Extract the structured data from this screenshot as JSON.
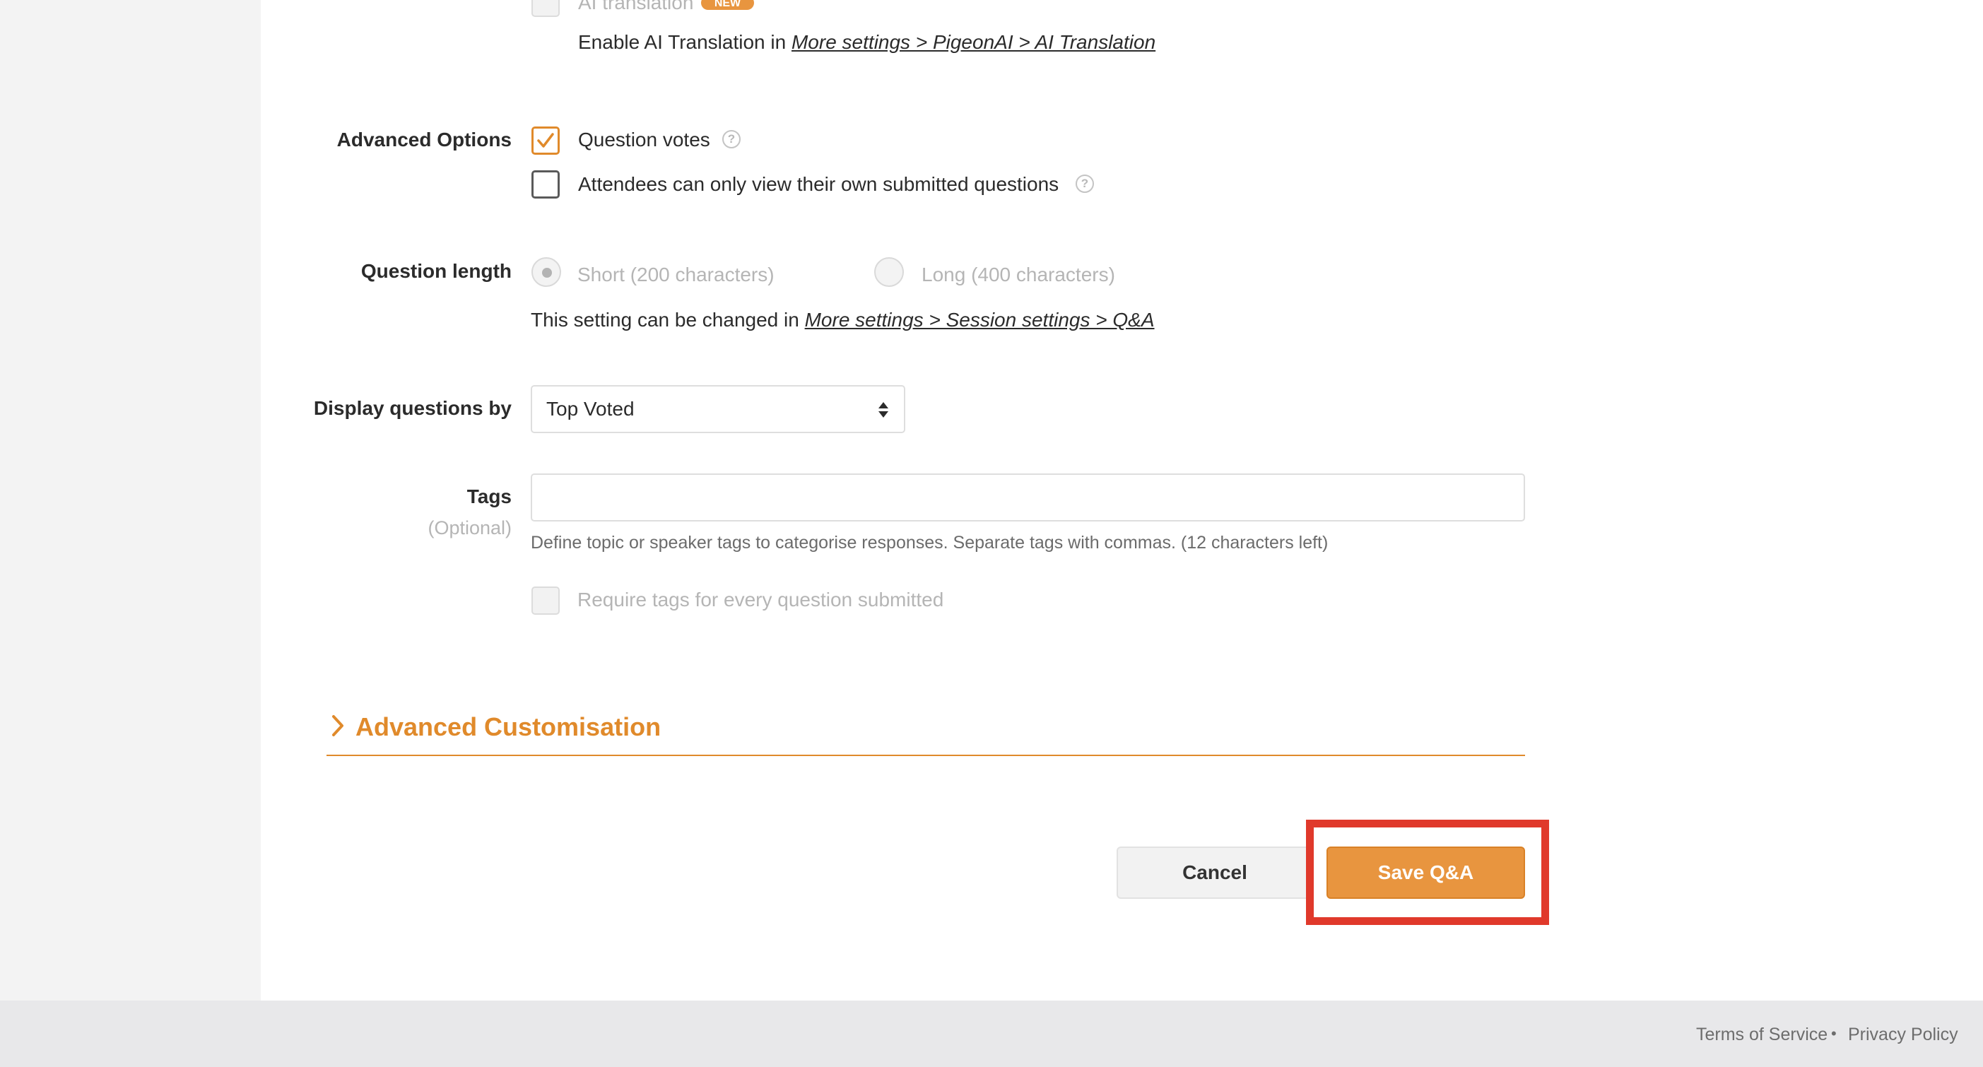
{
  "ai_translation": {
    "label": "AI translation",
    "badge": "NEW",
    "hint_prefix": "Enable AI Translation in",
    "hint_link": "More settings > PigeonAI > AI Translation"
  },
  "advanced_options": {
    "label": "Advanced Options",
    "question_votes": {
      "label": "Question votes",
      "checked": true
    },
    "own_questions_only": {
      "label": "Attendees can only view their own submitted questions",
      "checked": false
    }
  },
  "question_length": {
    "label": "Question length",
    "options": [
      "Short (200 characters)",
      "Long (400 characters)"
    ],
    "selected": "Short (200 characters)",
    "hint_prefix": "This setting can be changed in",
    "hint_link": "More settings > Session settings > Q&A"
  },
  "display_questions": {
    "label": "Display questions by",
    "value": "Top Voted"
  },
  "tags": {
    "label": "Tags",
    "optional": "(Optional)",
    "value": "",
    "help": "Define topic or speaker tags to categorise responses. Separate tags with commas. (12 characters left)",
    "require_label": "Require tags for every question submitted"
  },
  "advanced_customisation": {
    "label": "Advanced Customisation"
  },
  "actions": {
    "cancel": "Cancel",
    "save": "Save Q&A"
  },
  "footer": {
    "terms": "Terms of Service",
    "separator": "•",
    "privacy": "Privacy Policy"
  },
  "colors": {
    "accent": "#e8953f",
    "highlight": "#e0392b"
  }
}
